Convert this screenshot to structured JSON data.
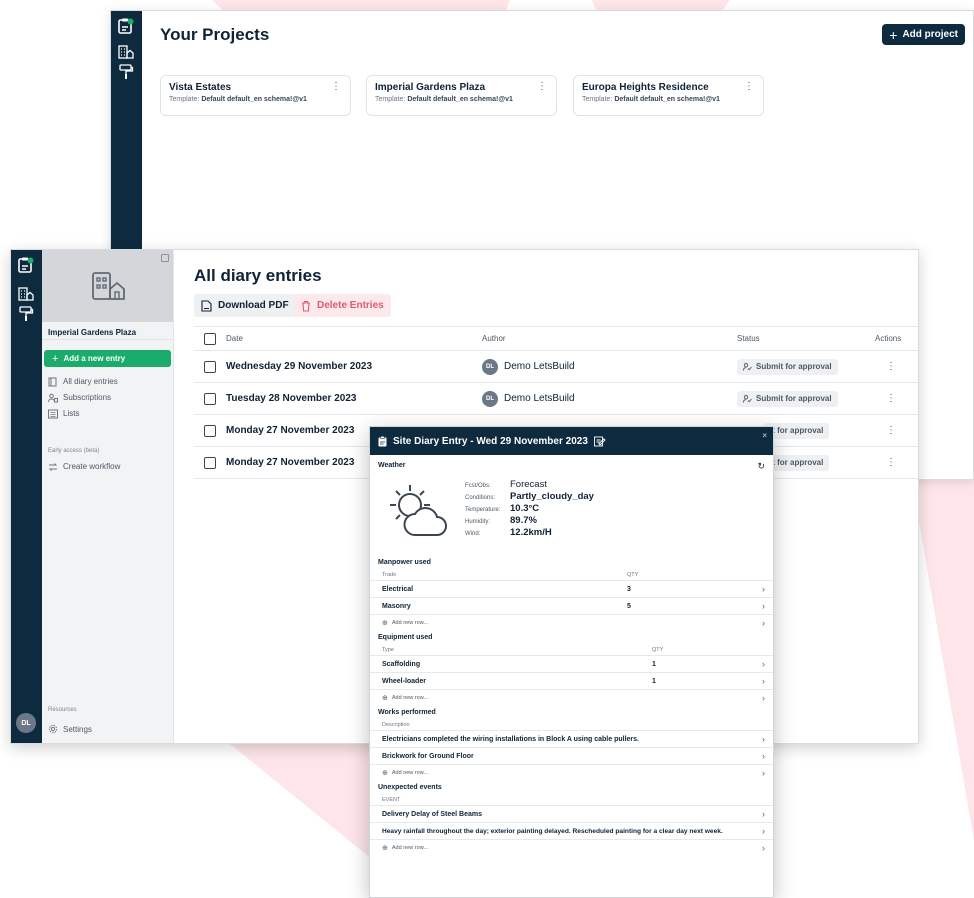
{
  "projects_window": {
    "title": "Your Projects",
    "add_button": "Add project",
    "cards": [
      {
        "name": "Vista Estates",
        "template_label": "Template:",
        "template_value": "Default default_en schema!@v1"
      },
      {
        "name": "Imperial Gardens Plaza",
        "template_label": "Template:",
        "template_value": "Default default_en schema!@v1"
      },
      {
        "name": "Europa Heights Residence",
        "template_label": "Template:",
        "template_value": "Default default_en schema!@v1"
      }
    ]
  },
  "diary_window": {
    "project_name": "Imperial Gardens Plaza",
    "sidebar": {
      "new_entry": "Add a new entry",
      "items": [
        "All diary entries",
        "Subscriptions",
        "Lists"
      ],
      "early_access": "Early access (beta)",
      "workflow": "Create workflow",
      "resources": "Resources",
      "settings": "Settings"
    },
    "user_initials": "DL",
    "title": "All diary entries",
    "download_pdf": "Download PDF",
    "delete_entries": "Delete Entries",
    "columns": {
      "date": "Date",
      "author": "Author",
      "status": "Status",
      "actions": "Actions"
    },
    "rows": [
      {
        "date": "Wednesday 29 November 2023",
        "author_initials": "DL",
        "author": "Demo LetsBuild",
        "status": "Submit for approval"
      },
      {
        "date": "Tuesday 28 November 2023",
        "author_initials": "DL",
        "author": "Demo LetsBuild",
        "status": "Submit for approval"
      },
      {
        "date": "Monday 27 November 2023",
        "status": "it for approval"
      },
      {
        "date": "Monday 27 November 2023",
        "status": "it for approval"
      }
    ]
  },
  "entry_modal": {
    "title": "Site Diary Entry - Wed 29 November 2023",
    "close": "×",
    "weather": {
      "heading": "Weather",
      "fcst_label": "Fcst/Obs:",
      "fcst_value": "Forecast",
      "conditions_label": "Conditions:",
      "conditions_value": "Partly_cloudy_day",
      "temperature_label": "Temperature:",
      "temperature_value": "10.3°C",
      "humidity_label": "Humidity:",
      "humidity_value": "89.7%",
      "wind_label": "Wind:",
      "wind_value": "12.2km/H"
    },
    "manpower": {
      "heading": "Manpower used",
      "col_trade": "Trade",
      "col_qty": "QTY",
      "rows": [
        {
          "trade": "Electrical",
          "qty": "3"
        },
        {
          "trade": "Masonry",
          "qty": "5"
        }
      ],
      "add_row": "Add new row..."
    },
    "equipment": {
      "heading": "Equipment used",
      "col_type": "Type",
      "col_qty": "QTY",
      "rows": [
        {
          "type": "Scaffolding",
          "qty": "1"
        },
        {
          "type": "Wheel-loader",
          "qty": "1"
        }
      ],
      "add_row": "Add new row..."
    },
    "works": {
      "heading": "Works performed",
      "col_description": "Description",
      "rows": [
        "Electricians completed the wiring installations in Block A using cable pullers.",
        "Brickwork for Ground Floor"
      ],
      "add_row": "Add new row..."
    },
    "unexpected": {
      "heading": "Unexpected events",
      "col_event": "EVENT",
      "rows": [
        "Delivery Delay of Steel Beams",
        "Heavy rainfall throughout the day; exterior painting delayed. Rescheduled painting for a clear day next week."
      ],
      "add_row": "Add new row..."
    }
  },
  "colors": {
    "navy": "#0d2a3f",
    "green": "#1bac6b",
    "pink_shape": "#fde5e9",
    "delete_red": "#e05a74"
  }
}
